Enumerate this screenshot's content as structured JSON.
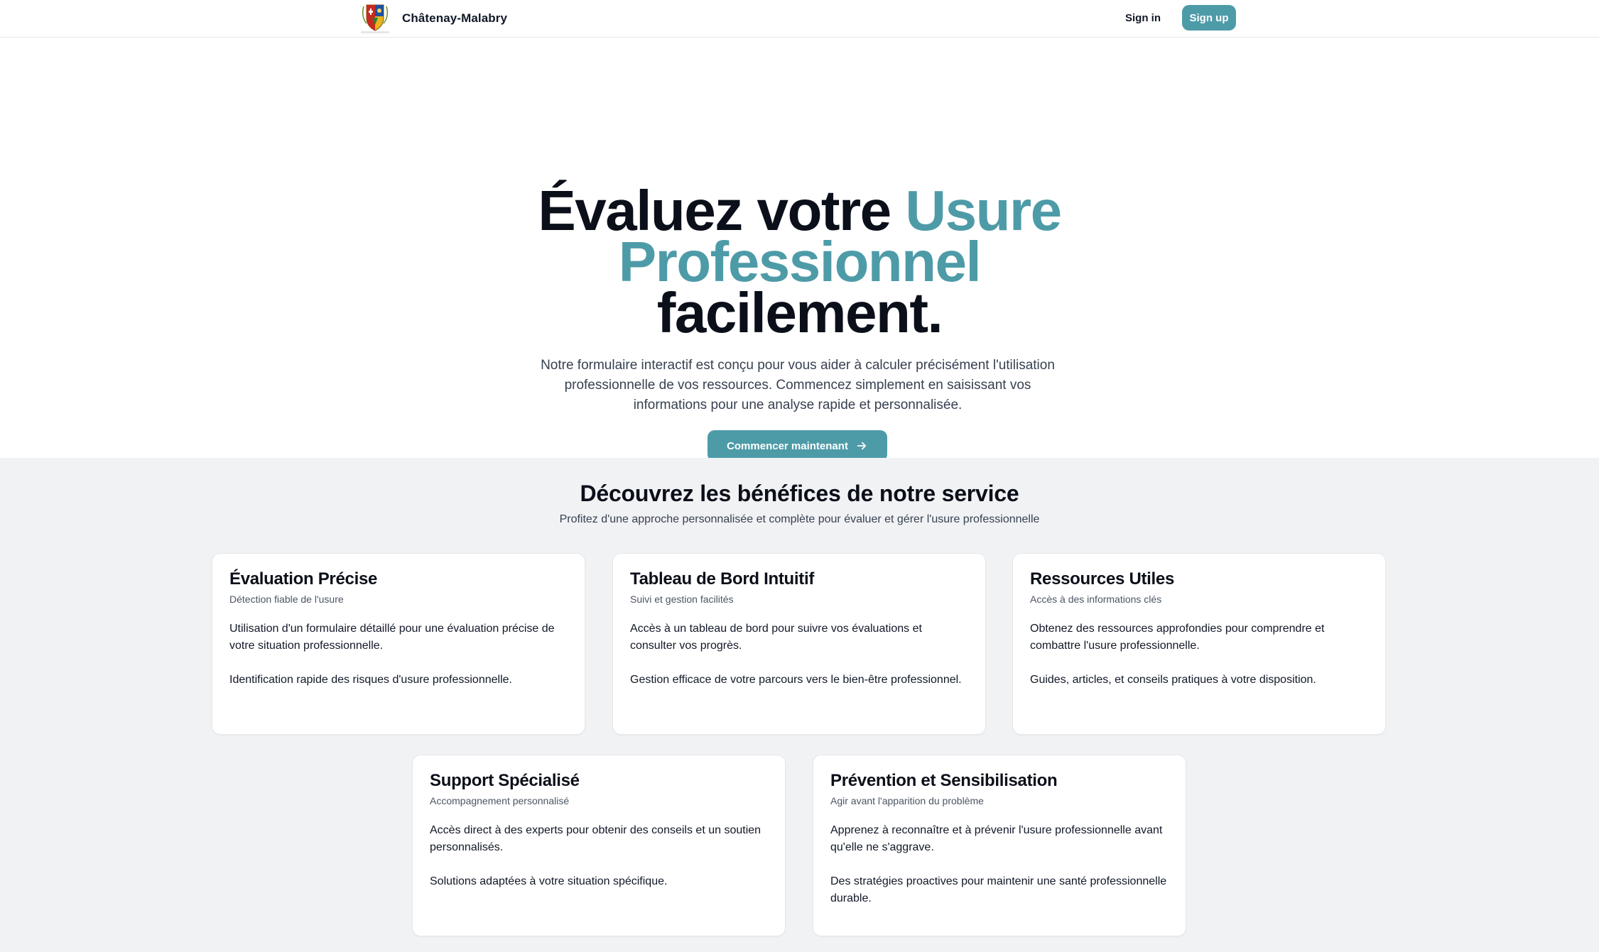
{
  "header": {
    "brand": "Châtenay-Malabry",
    "logo_caption": "Ville de Châtenay-Malabry",
    "sign_in": "Sign in",
    "sign_up": "Sign up"
  },
  "hero": {
    "title_part1": "Évaluez votre ",
    "title_accent_1": "Usure",
    "title_accent_2": "Professionnel",
    "title_part2": "facilement.",
    "subtitle": "Notre formulaire interactif est conçu pour vous aider à calculer précisément l'utilisation professionnelle de vos ressources. Commencez simplement en saisissant vos informations pour une analyse rapide et personnalisée.",
    "cta_label": "Commencer maintenant"
  },
  "benefits": {
    "title": "Découvrez les bénéfices de notre service",
    "subtitle": "Profitez d'une approche personnalisée et complète pour évaluer et gérer l'usure professionnelle",
    "cards": [
      {
        "title": "Évaluation Précise",
        "subtitle": "Détection fiable de l'usure",
        "p1": "Utilisation d'un formulaire détaillé pour une évaluation précise de votre situation professionnelle.",
        "p2": "Identification rapide des risques d'usure professionnelle."
      },
      {
        "title": "Tableau de Bord Intuitif",
        "subtitle": "Suivi et gestion facilités",
        "p1": "Accès à un tableau de bord pour suivre vos évaluations et consulter vos progrès.",
        "p2": "Gestion efficace de votre parcours vers le bien-être professionnel."
      },
      {
        "title": "Ressources Utiles",
        "subtitle": "Accès à des informations clés",
        "p1": "Obtenez des ressources approfondies pour comprendre et combattre l'usure professionnelle.",
        "p2": "Guides, articles, et conseils pratiques à votre disposition."
      },
      {
        "title": "Support Spécialisé",
        "subtitle": "Accompagnement personnalisé",
        "p1": "Accès direct à des experts pour obtenir des conseils et un soutien personnalisés.",
        "p2": "Solutions adaptées à votre situation spécifique."
      },
      {
        "title": "Prévention et Sensibilisation",
        "subtitle": "Agir avant l'apparition du problème",
        "p1": "Apprenez à reconnaître et à prévenir l'usure professionnelle avant qu'elle ne s'aggrave.",
        "p2": "Des stratégies proactives pour maintenir une santé professionnelle durable."
      }
    ]
  },
  "colors": {
    "accent": "#4e9ba8",
    "section_bg": "#f1f2f4",
    "text_dark": "#0b0f19"
  },
  "icons": {
    "logo": "city-coat-of-arms-icon",
    "cta_arrow": "arrow-right-icon"
  }
}
